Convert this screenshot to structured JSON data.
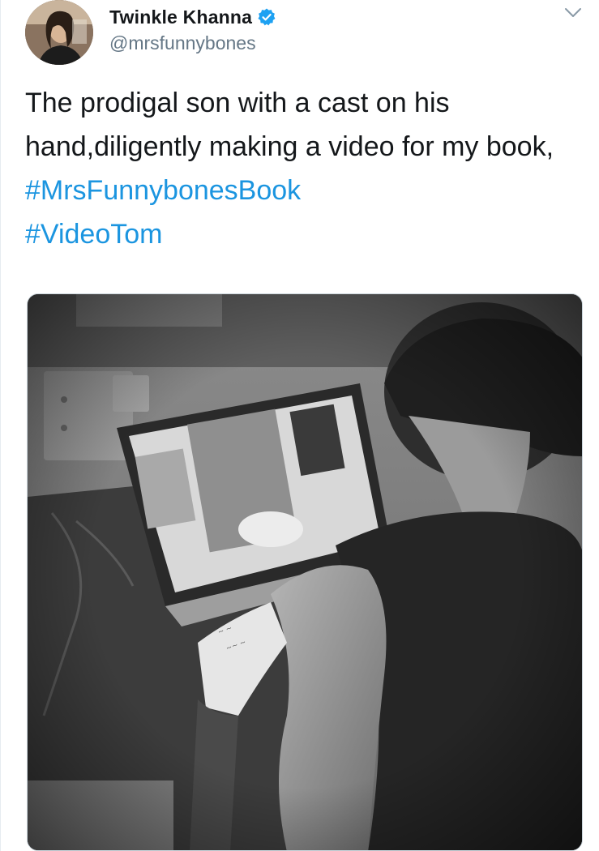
{
  "tweet": {
    "author": {
      "display_name": "Twinkle Khanna",
      "handle": "@mrsfunnybones",
      "verified": true
    },
    "text_parts": {
      "main": "The prodigal son with a cast on his hand,diligently making a video for my book, ",
      "hashtag_1": "#MrsFunnybonesBook",
      "hashtag_2": "#VideoTom"
    },
    "icons": {
      "verified": "verified-badge-icon",
      "menu": "chevron-down-icon"
    },
    "colors": {
      "hashtag": "#1b95e0",
      "verified": "#1da1f2",
      "text": "#14171a",
      "secondary": "#657786"
    }
  }
}
